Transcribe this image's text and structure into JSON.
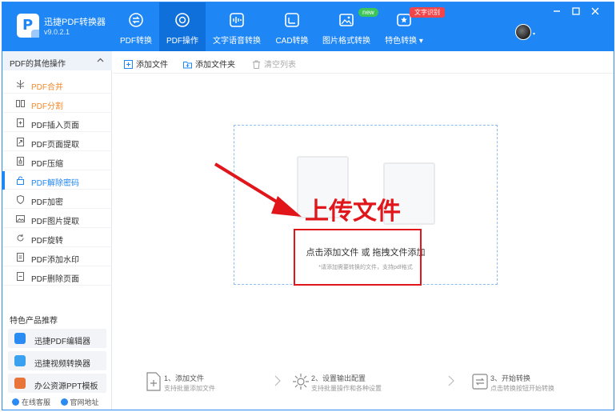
{
  "app": {
    "name": "迅捷PDF转换器",
    "version": "v9.0.2.1"
  },
  "nav": {
    "tabs": [
      {
        "label": "PDF转换",
        "icon": "convert-icon"
      },
      {
        "label": "PDF操作",
        "icon": "pdf-operation-icon",
        "active": true
      },
      {
        "label": "文字语音转换",
        "icon": "voice-icon"
      },
      {
        "label": "CAD转换",
        "icon": "cad-icon"
      },
      {
        "label": "图片格式转换",
        "icon": "image-icon"
      },
      {
        "label": "特色转换",
        "icon": "feature-icon"
      }
    ],
    "badges": {
      "new": "new",
      "ocr": "文字识别"
    }
  },
  "sidebar": {
    "header": "PDF的其他操作",
    "items": [
      {
        "label": "PDF合并",
        "style": "orange"
      },
      {
        "label": "PDF分割",
        "style": "orange"
      },
      {
        "label": "PDF插入页面"
      },
      {
        "label": "PDF页面提取"
      },
      {
        "label": "PDF压缩"
      },
      {
        "label": "PDF解除密码",
        "style": "selected"
      },
      {
        "label": "PDF加密"
      },
      {
        "label": "PDF图片提取"
      },
      {
        "label": "PDF旋转"
      },
      {
        "label": "PDF添加水印"
      },
      {
        "label": "PDF删除页面"
      }
    ],
    "featured_title": "特色产品推荐",
    "featured": [
      {
        "label": "迅捷PDF编辑器",
        "color": "#2a8bf2"
      },
      {
        "label": "迅捷视频转换器",
        "color": "#3aa0f0"
      },
      {
        "label": "办公资源PPT模板",
        "color": "#e8743a"
      }
    ],
    "footer": {
      "service": "在线客服",
      "website": "官网地址"
    }
  },
  "toolbar": {
    "add_file": "添加文件",
    "add_folder": "添加文件夹",
    "clear_list": "清空列表"
  },
  "dropzone": {
    "text": "点击添加文件 或 拖拽文件添加",
    "hint": "*请添加需要转换的文件，支持pdf格式"
  },
  "annotation": {
    "label": "上传文件"
  },
  "steps": [
    {
      "title": "1、添加文件",
      "subtitle": "支持批量添加文件"
    },
    {
      "title": "2、设置输出配置",
      "subtitle": "支持批量操作和各种设置"
    },
    {
      "title": "3、开始转换",
      "subtitle": "点击转换按钮开始转换"
    }
  ],
  "colors": {
    "primary": "#1e86f5",
    "accent_orange": "#f08a2c",
    "annotation_red": "#e0161b"
  }
}
